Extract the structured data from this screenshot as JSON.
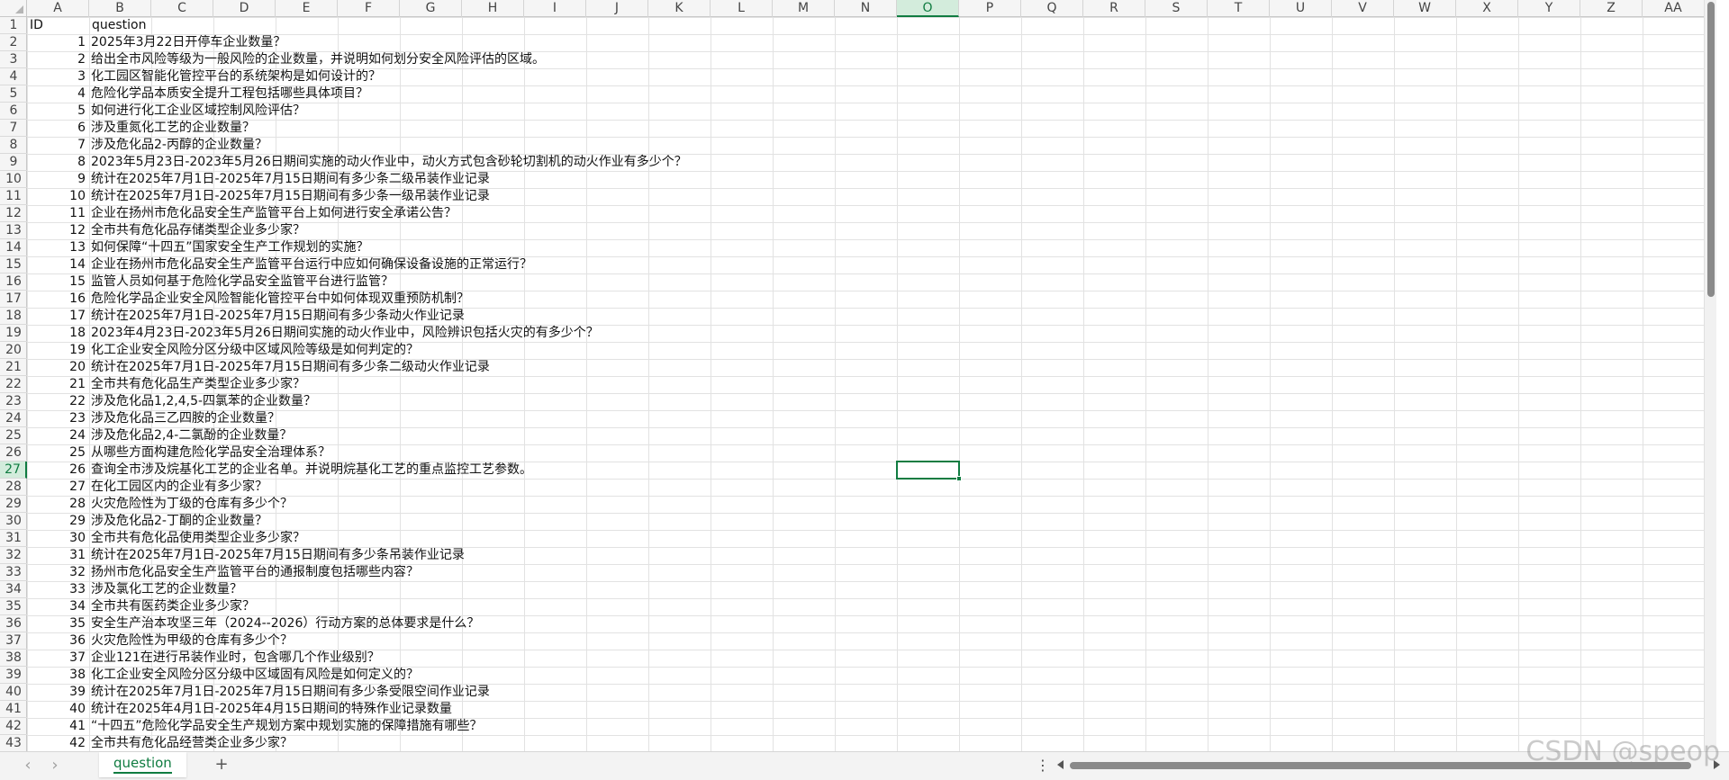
{
  "columns": [
    "A",
    "B",
    "C",
    "D",
    "E",
    "F",
    "G",
    "H",
    "I",
    "J",
    "K",
    "L",
    "M",
    "N",
    "O",
    "P",
    "Q",
    "R",
    "S",
    "T",
    "U",
    "V",
    "W",
    "X",
    "Y",
    "Z",
    "AA"
  ],
  "selected_column": "O",
  "selected_row": 27,
  "header_row": {
    "id": "ID",
    "question": "question"
  },
  "rows": [
    {
      "id": "1",
      "question": "2025年3月22日开停车企业数量？"
    },
    {
      "id": "2",
      "question": "给出全市风险等级为一般风险的企业数量，并说明如何划分安全风险评估的区域。"
    },
    {
      "id": "3",
      "question": "化工园区智能化管控平台的系统架构是如何设计的？"
    },
    {
      "id": "4",
      "question": "危险化学品本质安全提升工程包括哪些具体项目？"
    },
    {
      "id": "5",
      "question": "如何进行化工企业区域控制风险评估？"
    },
    {
      "id": "6",
      "question": "涉及重氮化工艺的企业数量？"
    },
    {
      "id": "7",
      "question": "涉及危化品2-丙醇的企业数量？"
    },
    {
      "id": "8",
      "question": "2023年5月23日-2023年5月26日期间实施的动火作业中，动火方式包含砂轮切割机的动火作业有多少个？"
    },
    {
      "id": "9",
      "question": "统计在2025年7月1日-2025年7月15日期间有多少条二级吊装作业记录"
    },
    {
      "id": "10",
      "question": "统计在2025年7月1日-2025年7月15日期间有多少条一级吊装作业记录"
    },
    {
      "id": "11",
      "question": "企业在扬州市危化品安全生产监管平台上如何进行安全承诺公告？"
    },
    {
      "id": "12",
      "question": "全市共有危化品存储类型企业多少家？"
    },
    {
      "id": "13",
      "question": "如何保障“十四五”国家安全生产工作规划的实施？"
    },
    {
      "id": "14",
      "question": "企业在扬州市危化品安全生产监管平台运行中应如何确保设备设施的正常运行？"
    },
    {
      "id": "15",
      "question": "监管人员如何基于危险化学品安全监管平台进行监管？"
    },
    {
      "id": "16",
      "question": "危险化学品企业安全风险智能化管控平台中如何体现双重预防机制？"
    },
    {
      "id": "17",
      "question": "统计在2025年7月1日-2025年7月15日期间有多少条动火作业记录"
    },
    {
      "id": "18",
      "question": "2023年4月23日-2023年5月26日期间实施的动火作业中，风险辨识包括火灾的有多少个？"
    },
    {
      "id": "19",
      "question": "化工企业安全风险分区分级中区域风险等级是如何判定的？"
    },
    {
      "id": "20",
      "question": "统计在2025年7月1日-2025年7月15日期间有多少条二级动火作业记录"
    },
    {
      "id": "21",
      "question": "全市共有危化品生产类型企业多少家？"
    },
    {
      "id": "22",
      "question": "涉及危化品1,2,4,5-四氯苯的企业数量？"
    },
    {
      "id": "23",
      "question": "涉及危化品三乙四胺的企业数量？"
    },
    {
      "id": "24",
      "question": "涉及危化品2,4-二氯酚的企业数量？"
    },
    {
      "id": "25",
      "question": "从哪些方面构建危险化学品安全治理体系？"
    },
    {
      "id": "26",
      "question": "查询全市涉及烷基化工艺的企业名单。并说明烷基化工艺的重点监控工艺参数。"
    },
    {
      "id": "27",
      "question": "在化工园区内的企业有多少家？"
    },
    {
      "id": "28",
      "question": "火灾危险性为丁级的仓库有多少个？"
    },
    {
      "id": "29",
      "question": "涉及危化品2-丁酮的企业数量？"
    },
    {
      "id": "30",
      "question": "全市共有危化品使用类型企业多少家？"
    },
    {
      "id": "31",
      "question": "统计在2025年7月1日-2025年7月15日期间有多少条吊装作业记录"
    },
    {
      "id": "32",
      "question": "扬州市危化品安全生产监管平台的通报制度包括哪些内容？"
    },
    {
      "id": "33",
      "question": "涉及氯化工艺的企业数量？"
    },
    {
      "id": "34",
      "question": "全市共有医药类企业多少家？"
    },
    {
      "id": "35",
      "question": "安全生产治本攻坚三年（2024--2026）行动方案的总体要求是什么？"
    },
    {
      "id": "36",
      "question": "火灾危险性为甲级的仓库有多少个？"
    },
    {
      "id": "37",
      "question": "企业121在进行吊装作业时，包含哪几个作业级别？"
    },
    {
      "id": "38",
      "question": "化工企业安全风险分区分级中区域固有风险是如何定义的？"
    },
    {
      "id": "39",
      "question": "统计在2025年7月1日-2025年7月15日期间有多少条受限空间作业记录"
    },
    {
      "id": "40",
      "question": "统计在2025年4月1日-2025年4月15日期间的特殊作业记录数量"
    },
    {
      "id": "41",
      "question": "“十四五”危险化学品安全生产规划方案中规划实施的保障措施有哪些？"
    },
    {
      "id": "42",
      "question": "全市共有危化品经营类企业多少家？"
    }
  ],
  "sheet_tabs": [
    "question"
  ],
  "add_sheet_label": "+",
  "nav_prev": "‹",
  "nav_next": "›",
  "more_label": "⋮",
  "watermark": "CSDN @speop",
  "colors": {
    "accent": "#107c41",
    "gridline": "#e2e2e2",
    "header_bg": "#f5f5f5"
  }
}
